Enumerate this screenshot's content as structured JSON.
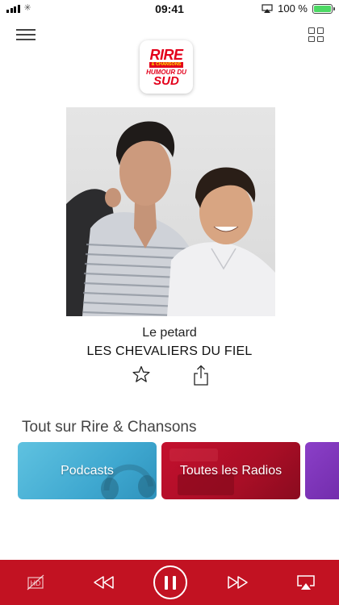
{
  "status_bar": {
    "time": "09:41",
    "battery_text": "100 %",
    "activity_glyph": "✳"
  },
  "header": {
    "menu_icon": "hamburger-menu-icon",
    "grid_icon": "grid-icon"
  },
  "logo": {
    "line1": "RIRE",
    "line2": "& CHANSONS",
    "line3": "HUMOUR DU",
    "line4": "SUD"
  },
  "now_playing": {
    "subtitle": "Le petard",
    "title": "LES CHEVALIERS DU FIEL"
  },
  "section": {
    "title": "Tout sur Rire & Chansons",
    "cards": [
      {
        "label": "Podcasts"
      },
      {
        "label": "Toutes les Radios"
      },
      {
        "label": ""
      }
    ]
  },
  "player": {
    "hd_label": "HD",
    "icons": [
      "hd-off-icon",
      "rewind-icon",
      "pause-icon",
      "fast-forward-icon",
      "airplay-icon"
    ]
  },
  "colors": {
    "brand_red": "#c21222",
    "logo_red": "#e3001b",
    "logo_yellow": "#ffe100",
    "podcasts_card": "#4fb6dc",
    "radios_card": "#b10f28",
    "third_card": "#7f36b8",
    "battery_green": "#4cd964"
  }
}
